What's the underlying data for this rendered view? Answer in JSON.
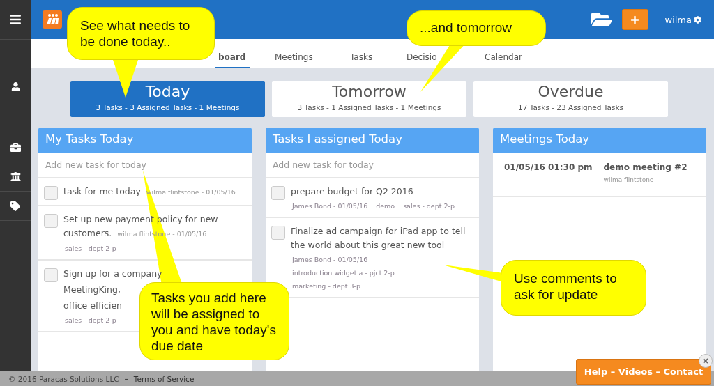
{
  "header": {
    "user": "wilma"
  },
  "tabs": [
    {
      "label": "board",
      "selected": true
    },
    {
      "label": "Meetings",
      "selected": false
    },
    {
      "label": "Tasks",
      "selected": false
    },
    {
      "label": "Decisio",
      "selected": false
    },
    {
      "label": "Calendar",
      "selected": false
    }
  ],
  "summary": [
    {
      "title": "Today",
      "detail": "3 Tasks - 3 Assigned Tasks - 1 Meetings",
      "selected": true
    },
    {
      "title": "Tomorrow",
      "detail": "3 Tasks - 1 Assigned Tasks - 1 Meetings",
      "selected": false
    },
    {
      "title": "Overdue",
      "detail": "17 Tasks - 23 Assigned Tasks",
      "selected": false
    }
  ],
  "my_tasks": {
    "title": "My Tasks Today",
    "placeholder": "Add new task for today",
    "items": [
      {
        "title": "task for me today",
        "byline": "wilma flintstone - 01/05/16",
        "checked": false
      },
      {
        "title": "Set up new payment policy for new customers.",
        "byline": "wilma flintstone - 01/05/16",
        "tags": [
          [
            "sales - dept 2-p"
          ]
        ],
        "checked": false
      },
      {
        "title": "Sign up for a company\nMeetingKing,\noffice efficien",
        "tags": [
          [
            "sales - dept 2-p"
          ]
        ],
        "checked": false
      }
    ]
  },
  "assigned_tasks": {
    "title": "Tasks I assigned Today",
    "placeholder": "Add new task for today",
    "items": [
      {
        "title": "prepare budget for Q2 2016",
        "tags": [
          [
            "James Bond - 01/05/16",
            "demo",
            "sales - dept 2-p"
          ]
        ],
        "checked": false
      },
      {
        "title": "Finalize ad campaign for iPad app to tell the world about this great new tool",
        "tags": [
          [
            "James Bond - 01/05/16"
          ],
          [
            "introduction widget a - pjct 2-p"
          ],
          [
            "marketing - dept 3-p"
          ]
        ],
        "checked": false
      }
    ]
  },
  "meetings": {
    "title": "Meetings Today",
    "items": [
      {
        "time": "01/05/16 01:30 pm",
        "name": "demo meeting #2",
        "owner": "wilma flintstone"
      }
    ]
  },
  "footer": {
    "copyright": "© 2016 Paracas Solutions LLC",
    "separator": "–",
    "link": "Terms of Service"
  },
  "help_button": "Help – Videos – Contact",
  "callouts": [
    {
      "text": "See what needs to be done today.."
    },
    {
      "text": "...and tomorrow"
    },
    {
      "text": "Tasks you add here will be assigned to you and have today's due date"
    },
    {
      "text": "Use comments to ask for update"
    }
  ]
}
